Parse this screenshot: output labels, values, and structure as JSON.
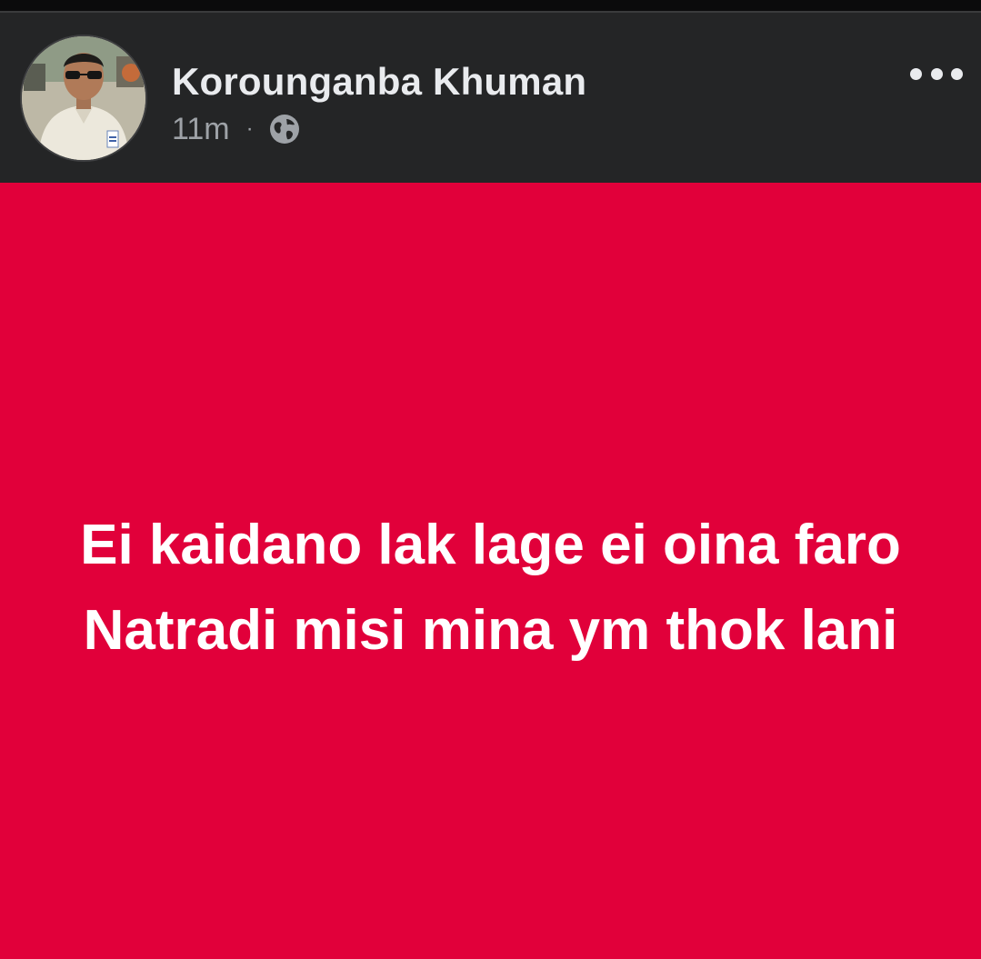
{
  "post": {
    "author_name": "Korounganba Khuman",
    "timestamp": "11m",
    "separator": "·",
    "privacy_icon": "globe-icon",
    "more_icon": "more-horizontal-icon",
    "background_color": "#e1003a",
    "text_lines": [
      "Ei kaidano lak lage ei oina faro",
      "Natradi misi mina ym thok lani"
    ]
  }
}
